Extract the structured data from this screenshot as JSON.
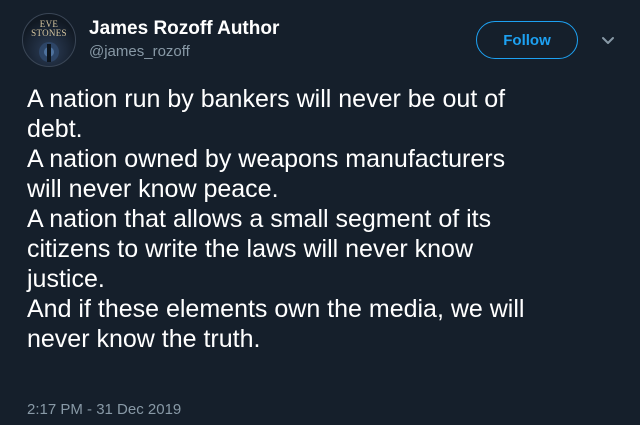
{
  "author": {
    "display_name": "James Rozoff Author",
    "handle": "@james_rozoff",
    "avatar_text": "EVE\nSTONES",
    "avatar_icon": "book-cover-avatar"
  },
  "actions": {
    "follow_label": "Follow",
    "more_icon": "chevron-down-icon"
  },
  "tweet": {
    "lines": [
      "A nation run by bankers will never be out of",
      "debt.",
      "A nation owned by weapons manufacturers",
      "will never know peace.",
      "A nation that allows a small segment of its",
      "citizens to write the laws will never know",
      "justice.",
      "And if these elements own the media, we will",
      "never know the truth."
    ],
    "timestamp": "2:17 PM - 31 Dec 2019"
  },
  "colors": {
    "background": "#151f2b",
    "accent": "#1da1f2",
    "secondary_text": "#8899a6",
    "primary_text": "#ffffff"
  }
}
